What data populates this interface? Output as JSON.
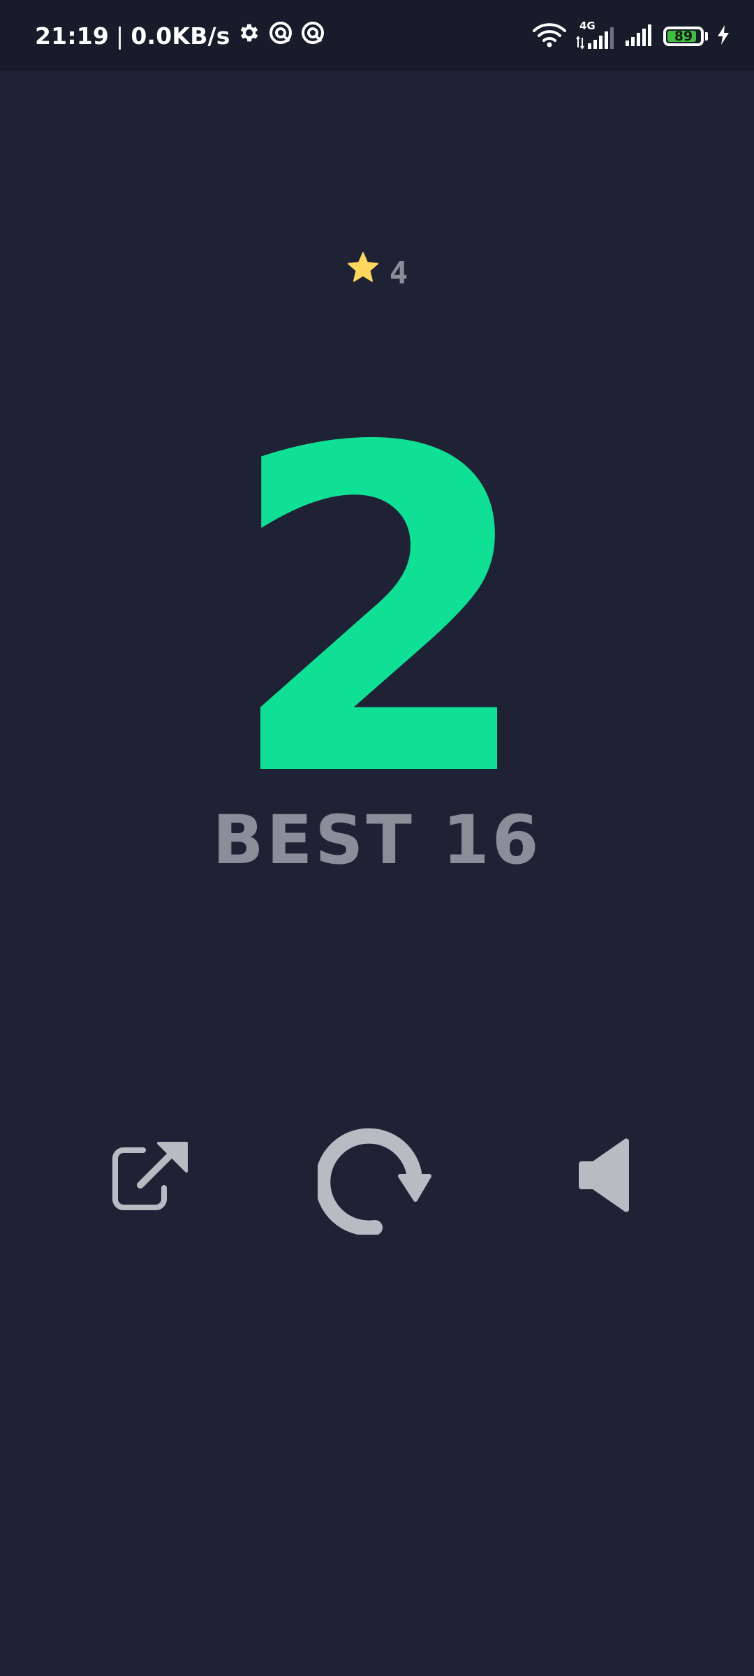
{
  "status_bar": {
    "time": "21:19",
    "separator": "|",
    "network_speed": "0.0KB/s",
    "network_type": "4G",
    "battery_level": "89",
    "battery_fill_fraction": 0.89,
    "icons": [
      "gear-icon",
      "app-notification-icon",
      "app-notification-icon",
      "wifi-icon",
      "cellular-signal-icon",
      "cellular-signal-icon",
      "battery-icon",
      "charging-bolt-icon"
    ]
  },
  "game": {
    "stars_count": "4",
    "score": "2",
    "best_label": "BEST",
    "best_value": "16"
  },
  "controls": {
    "share_icon": "share-external-icon",
    "restart_icon": "restart-icon",
    "sound_icon": "speaker-icon"
  },
  "colors": {
    "background": "#1f2235",
    "status_bar_bg": "#181b2a",
    "score": "#10e095",
    "muted_text": "#8b8e99",
    "icon": "#b9bbc2",
    "star": "#ffd75e",
    "battery_fill": "#3fbf3f"
  }
}
